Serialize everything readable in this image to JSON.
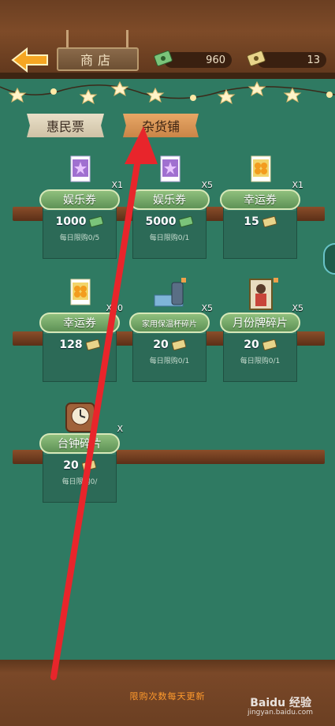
{
  "header": {
    "title": "商店"
  },
  "currencies": [
    {
      "icon": "cash-icon",
      "value": "960"
    },
    {
      "icon": "ticket-icon",
      "value": "13"
    }
  ],
  "tabs": [
    {
      "label": "惠民票",
      "active": false
    },
    {
      "label": "杂货铺",
      "active": true
    }
  ],
  "items": [
    {
      "name": "娱乐券",
      "qty": "X1",
      "price": "1000",
      "limit": "每日限购0/5",
      "icon": "purple-ticket-icon"
    },
    {
      "name": "娱乐券",
      "qty": "X5",
      "price": "5000",
      "limit": "每日限购0/1",
      "icon": "purple-ticket-icon"
    },
    {
      "name": "幸运券",
      "qty": "X1",
      "price": "15",
      "limit": "",
      "icon": "clover-ticket-icon"
    },
    {
      "name": "幸运券",
      "qty": "X10",
      "price": "128",
      "limit": "",
      "icon": "clover-ticket-icon"
    },
    {
      "name": "家用保温杯碎片",
      "qty": "X5",
      "price": "20",
      "limit": "每日限购0/1",
      "icon": "thermos-fragment-icon"
    },
    {
      "name": "月份牌碎片",
      "qty": "X5",
      "price": "20",
      "limit": "每日限购0/1",
      "icon": "calendar-poster-fragment-icon"
    },
    {
      "name": "台钟碎片",
      "qty": "X",
      "price": "20",
      "limit": "每日限购0/",
      "icon": "desk-clock-fragment-icon"
    }
  ],
  "footer": {
    "note": "限购次数每天更新"
  },
  "watermark": {
    "brand": "Baidu 经验",
    "url": "jingyan.baidu.com"
  },
  "colors": {
    "background": "#2f7a62",
    "wood": "#6b3f22",
    "accent_arrow": "#e8252b",
    "footer_note": "#ff9a2c"
  }
}
